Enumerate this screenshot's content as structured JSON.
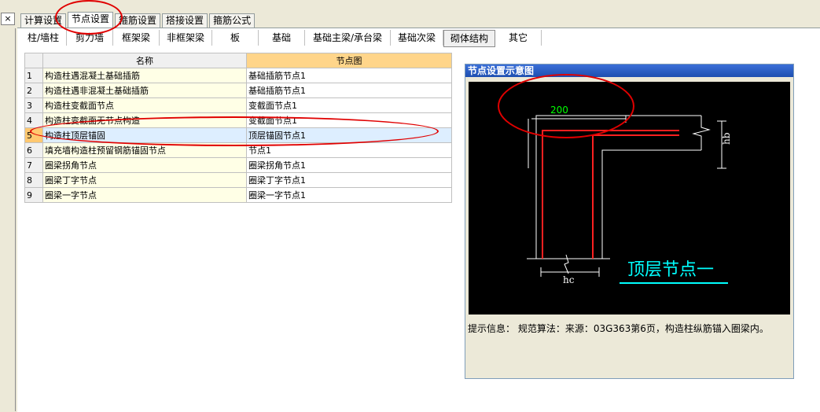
{
  "top_tabs": [
    "计算设置",
    "节点设置",
    "箍筋设置",
    "搭接设置",
    "箍筋公式"
  ],
  "active_top_tab": 1,
  "sub_tabs": [
    "柱/墙柱",
    "剪力墙",
    "框架梁",
    "非框架梁",
    "板",
    "基础",
    "基础主梁/承台梁",
    "基础次梁",
    "砌体结构",
    "其它"
  ],
  "active_sub_tab": 8,
  "table": {
    "columns": [
      "名称",
      "节点图"
    ],
    "rows": [
      {
        "no": "1",
        "name": "构造柱遇混凝土基础插筋",
        "diagram": "基础插筋节点1"
      },
      {
        "no": "2",
        "name": "构造柱遇非混凝土基础插筋",
        "diagram": "基础插筋节点1"
      },
      {
        "no": "3",
        "name": "构造柱变截面节点",
        "diagram": "变截面节点1"
      },
      {
        "no": "4",
        "name": "构造柱变截面无节点构造",
        "diagram": "变截面节点1"
      },
      {
        "no": "5",
        "name": "构造柱顶层锚固",
        "diagram": "顶层锚固节点1"
      },
      {
        "no": "6",
        "name": "填充墙构造柱预留钢筋锚固节点",
        "diagram": "节点1"
      },
      {
        "no": "7",
        "name": "圈梁拐角节点",
        "diagram": "圈梁拐角节点1"
      },
      {
        "no": "8",
        "name": "圈梁丁字节点",
        "diagram": "圈梁丁字节点1"
      },
      {
        "no": "9",
        "name": "圈梁一字节点",
        "diagram": "圈梁一字节点1"
      }
    ],
    "selected_row": 4
  },
  "panel": {
    "title": "节点设置示意图",
    "dim_value": "200",
    "dim_hb": "hb",
    "dim_hc": "hc",
    "diagram_caption": "顶层节点一",
    "hint": "提示信息： 规范算法：来源：03G363第6页，构造柱纵筋锚入圈梁内。"
  },
  "close_button": "×",
  "colors": {
    "annotation_red": "#e00000",
    "dim_green": "#00ff00",
    "caption_cyan": "#00ffff",
    "rebar_red": "#ff2020"
  }
}
